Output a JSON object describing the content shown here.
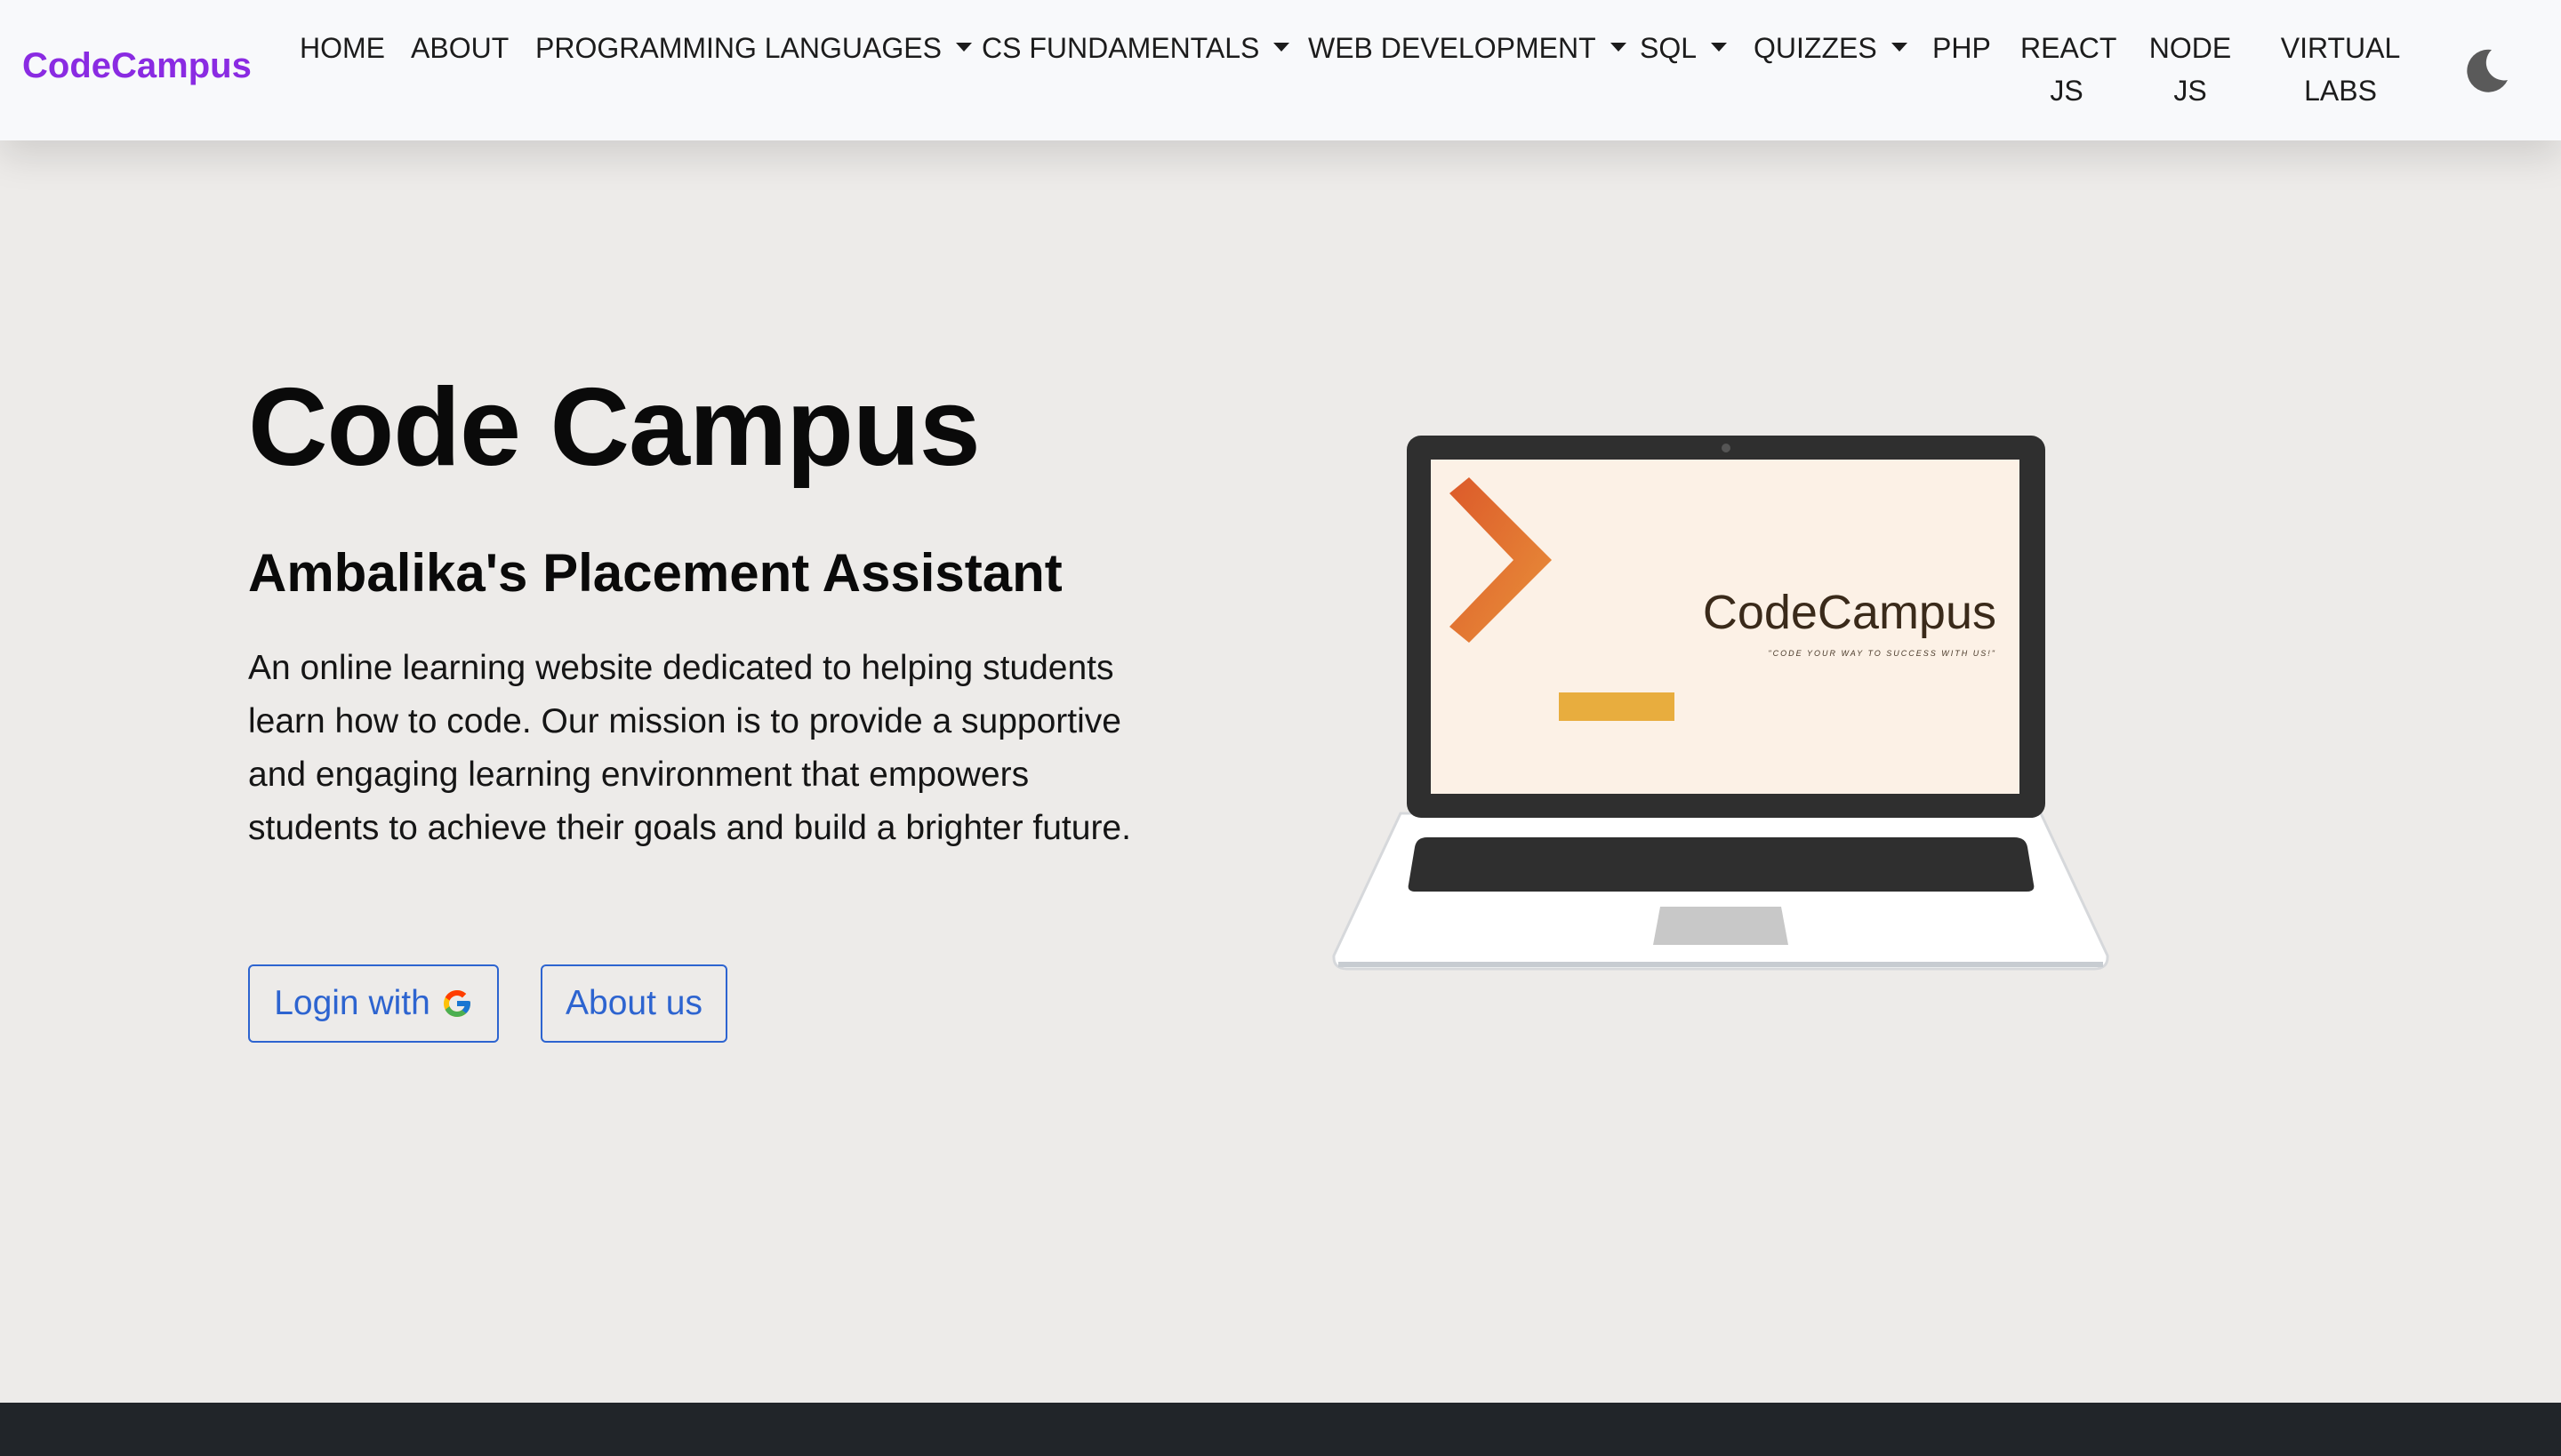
{
  "navbar": {
    "brand": "CodeCampus",
    "items": [
      {
        "label": "HOME"
      },
      {
        "label": "ABOUT"
      },
      {
        "label": "PROGRAMMING LANGUAGES"
      },
      {
        "label": "CS FUNDAMENTALS"
      },
      {
        "label": "WEB DEVELOPMENT"
      },
      {
        "label": "SQL"
      },
      {
        "label": "QUIZZES"
      },
      {
        "label": "PHP"
      },
      {
        "label": "REACT",
        "label2": "JS"
      },
      {
        "label": "NODE",
        "label2": "JS"
      },
      {
        "label": "VIRTUAL",
        "label2": "LABS"
      }
    ],
    "theme_icon": "moon-icon"
  },
  "hero": {
    "title": "Code Campus",
    "subtitle": "Ambalika's Placement Assistant",
    "description": "An online learning website dedicated to helping students learn how to code. Our mission is to provide a supportive and engaging learning environment that empowers students to achieve their goals and build a brighter future.",
    "login_label": "Login with",
    "login_icon": "google-icon",
    "about_label": "About us"
  },
  "illustration": {
    "screen_brand": "CodeCampus",
    "screen_tagline": "\"CODE YOUR WAY TO SUCCESS WITH US!\""
  },
  "colors": {
    "brand": "#8a2be2",
    "accent": "#2d64d0",
    "page_bg": "#edebe9",
    "footer": "#212529"
  }
}
